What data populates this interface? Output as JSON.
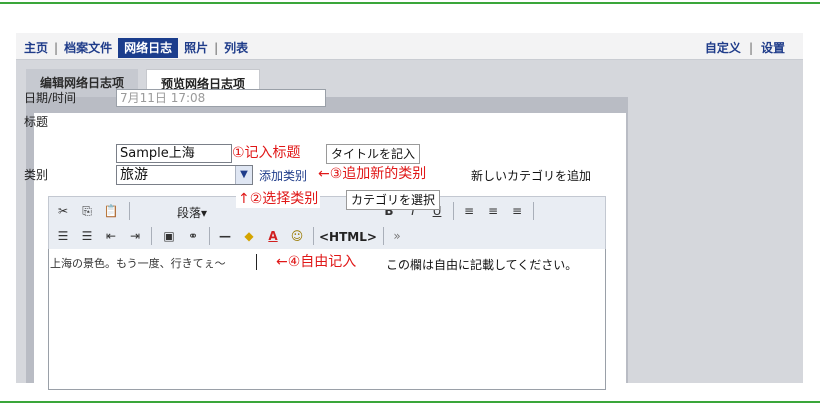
{
  "nav": {
    "items": [
      "主页",
      "档案文件",
      "网络日志",
      "照片",
      "列表"
    ],
    "active_index": 2,
    "right_items": [
      "自定义",
      "设置"
    ]
  },
  "tabs": {
    "edit": "编辑网络日志项",
    "preview": "预览网络日志项"
  },
  "form": {
    "date_label": "日期/时间",
    "date_value": "7月11日 17:08",
    "title_label": "标题",
    "title_value": "Sample上海",
    "category_label": "类别",
    "category_value": "旅游",
    "add_category": "添加类别"
  },
  "annotations": {
    "a1_red": "①记入标题",
    "a1_note": "タイトルを記入",
    "a2_red": "↑②选择类别",
    "a2_note": "カテゴリを選択",
    "a3_red": "←③追加新的类别",
    "a3_note": "新しいカテゴリを追加",
    "a4_red": "←④自由记入",
    "a4_note": "この欄は自由に記載してください。"
  },
  "toolbar": {
    "paragraph": "段落▾",
    "html": "<HTML>",
    "icons": [
      "cut-icon",
      "copy-icon",
      "paste-icon",
      "bold-icon",
      "italic-icon",
      "underline-icon",
      "align-left-icon",
      "align-center-icon",
      "align-right-icon",
      "ordered-list-icon",
      "unordered-list-icon",
      "outdent-icon",
      "indent-icon",
      "image-icon",
      "link-icon",
      "horizontal-rule-icon",
      "highlight-icon",
      "font-color-icon",
      "emoticon-icon",
      "more-icon"
    ]
  },
  "editor": {
    "content": "上海の景色。もう一度、行きてぇ～"
  }
}
